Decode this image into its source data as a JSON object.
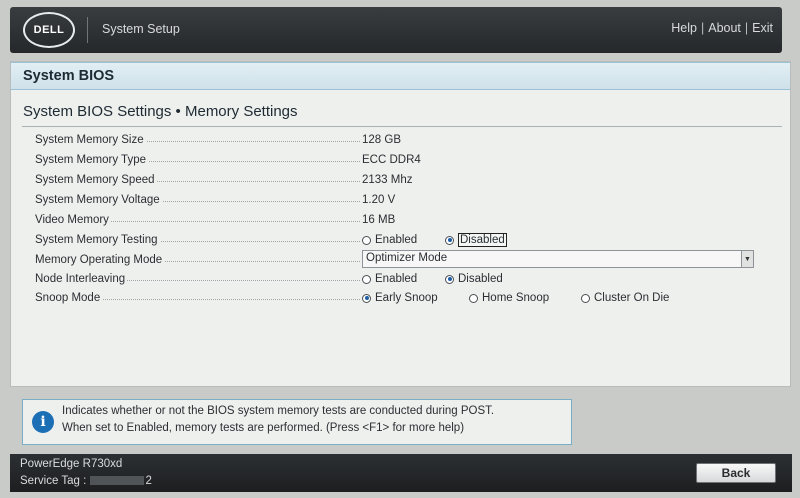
{
  "header": {
    "logo_text": "DELL",
    "title": "System Setup",
    "links": [
      "Help",
      "About",
      "Exit"
    ],
    "separator": "|"
  },
  "bios": {
    "header": "System BIOS",
    "section_title": "System BIOS Settings • Memory Settings"
  },
  "settings": {
    "memory_size": {
      "label": "System Memory Size",
      "value": "128 GB"
    },
    "memory_type": {
      "label": "System Memory Type",
      "value": "ECC DDR4"
    },
    "memory_speed": {
      "label": "System Memory Speed",
      "value": "2133 Mhz"
    },
    "memory_voltage": {
      "label": "System Memory Voltage",
      "value": "1.20 V"
    },
    "video_memory": {
      "label": "Video Memory",
      "value": "16 MB"
    },
    "memory_testing": {
      "label": "System Memory Testing",
      "options": [
        "Enabled",
        "Disabled"
      ],
      "selected": "Disabled"
    },
    "operating_mode": {
      "label": "Memory Operating Mode",
      "value": "Optimizer Mode"
    },
    "node_interleaving": {
      "label": "Node Interleaving",
      "options": [
        "Enabled",
        "Disabled"
      ],
      "selected": "Disabled"
    },
    "snoop_mode": {
      "label": "Snoop Mode",
      "options": [
        "Early Snoop",
        "Home Snoop",
        "Cluster On Die"
      ],
      "selected": "Early Snoop"
    }
  },
  "help": {
    "icon": "info-icon",
    "line1": "Indicates whether or not the BIOS system memory tests are conducted during POST.",
    "line2": "When set to Enabled, memory tests are performed. (Press <F1> for more help)"
  },
  "footer": {
    "model": "PowerEdge R730xd",
    "service_tag_label": "Service Tag :",
    "service_tag_value": "2",
    "back_label": "Back"
  },
  "colors": {
    "accent": "#1c6fb5",
    "header_bg": "#2d3033",
    "panel_bg": "#eef0ee"
  }
}
